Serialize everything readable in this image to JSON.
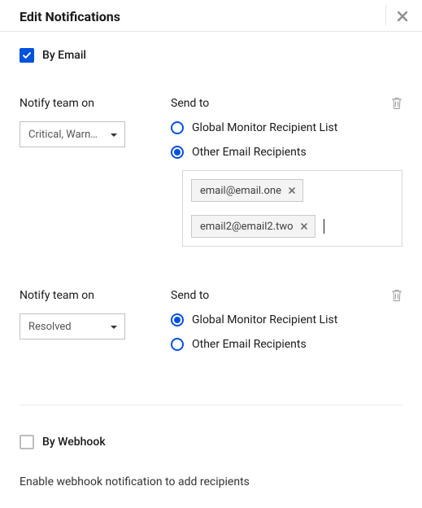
{
  "header": {
    "title": "Edit Notifications"
  },
  "byEmail": {
    "label": "By Email",
    "checked": true
  },
  "rules": [
    {
      "notifyLabel": "Notify team on",
      "selectValue": "Critical, Warn…",
      "sendToLabel": "Send to",
      "options": {
        "global": "Global Monitor Recipient List",
        "other": "Other Email Recipients"
      },
      "selected": "other",
      "emails": [
        "email@email.one",
        "email2@email2.two"
      ]
    },
    {
      "notifyLabel": "Notify team on",
      "selectValue": "Resolved",
      "sendToLabel": "Send to",
      "options": {
        "global": "Global Monitor Recipient List",
        "other": "Other Email Recipients"
      },
      "selected": "global"
    }
  ],
  "byWebhook": {
    "label": "By Webhook",
    "checked": false,
    "helper": "Enable webhook notification to add recipients"
  }
}
